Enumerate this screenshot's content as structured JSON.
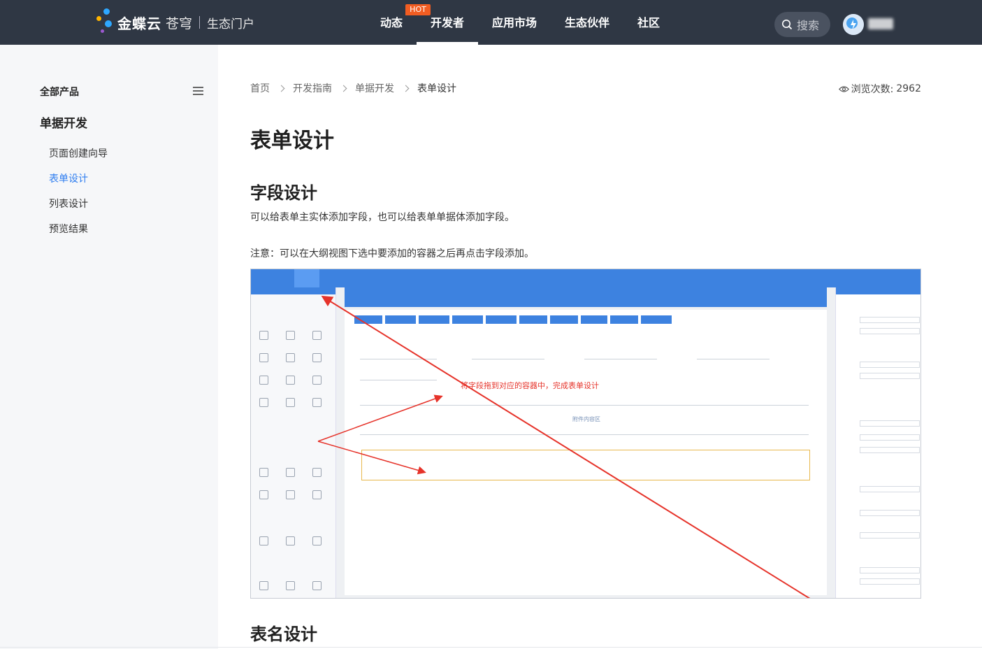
{
  "brand": {
    "name": "金蝶云",
    "sub": "苍穹",
    "portal": "生态门户"
  },
  "nav": {
    "items": [
      "动态",
      "开发者",
      "应用市场",
      "生态伙伴",
      "社区"
    ],
    "active": "开发者",
    "hot_badge": "HOT"
  },
  "search": {
    "label": "搜索"
  },
  "sidebar": {
    "all_products": "全部产品",
    "section": "单据开发",
    "items": [
      "页面创建向导",
      "表单设计",
      "列表设计",
      "预览结果"
    ],
    "active": "表单设计"
  },
  "breadcrumb": [
    "首页",
    "开发指南",
    "单据开发",
    "表单设计"
  ],
  "views": {
    "label": "浏览次数:",
    "count": "2962"
  },
  "article": {
    "title": "表单设计",
    "h_field": "字段设计",
    "p1": "可以给表单主实体添加字段，也可以给表单单据体添加字段。",
    "p2": "注意：可以在大纲视图下选中要添加的容器之后再点击字段添加。",
    "h_table": "表名设计"
  },
  "screenshot": {
    "annotation": "将字段拖到对应的容器中，完成表单设计",
    "attach_text": "附件内容区"
  },
  "colors": {
    "topbar": "#2f3744",
    "accent": "#2f7ef0",
    "hot": "#f25d22",
    "annotation": "#e6332a",
    "designer_blue": "#3d82e0"
  }
}
